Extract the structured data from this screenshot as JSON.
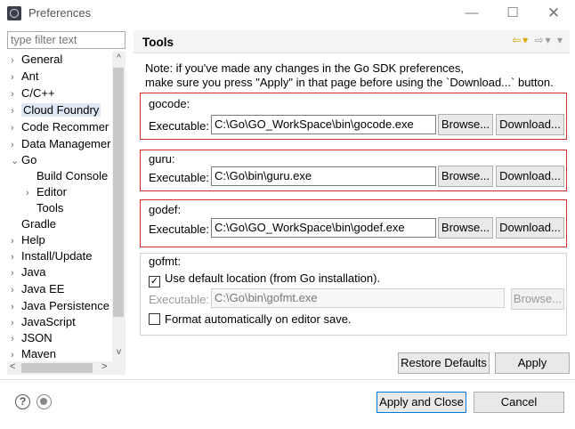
{
  "window": {
    "title": "Preferences",
    "minimize": "—",
    "maximize": "☐",
    "close": "✕"
  },
  "sidebar": {
    "filter_placeholder": "type filter text",
    "items": [
      {
        "label": "General",
        "arrow": "›"
      },
      {
        "label": "Ant",
        "arrow": "›"
      },
      {
        "label": "C/C++",
        "arrow": "›"
      },
      {
        "label": "Cloud Foundry",
        "arrow": "›"
      },
      {
        "label": "Code Recommer",
        "arrow": "›"
      },
      {
        "label": "Data Managemer",
        "arrow": "›"
      },
      {
        "label": "Go",
        "arrow": "⌄"
      },
      {
        "label": "Build Console",
        "arrow": ""
      },
      {
        "label": "Editor",
        "arrow": "›"
      },
      {
        "label": "Tools",
        "arrow": ""
      },
      {
        "label": "Gradle",
        "arrow": ""
      },
      {
        "label": "Help",
        "arrow": "›"
      },
      {
        "label": "Install/Update",
        "arrow": "›"
      },
      {
        "label": "Java",
        "arrow": "›"
      },
      {
        "label": "Java EE",
        "arrow": "›"
      },
      {
        "label": "Java Persistence",
        "arrow": "›"
      },
      {
        "label": "JavaScript",
        "arrow": "›"
      },
      {
        "label": "JSON",
        "arrow": "›"
      },
      {
        "label": "Maven",
        "arrow": "›"
      }
    ]
  },
  "panel": {
    "title": "Tools",
    "note_line1": "Note: if you've made any changes in the Go SDK preferences,",
    "note_line2": "make sure you press \"Apply\" in that page before using the `Download...` button.",
    "executable_label": "Executable:",
    "browse_label": "Browse...",
    "download_label": "Download...",
    "gocode": {
      "title": "gocode:",
      "path": "C:\\Go\\GO_WorkSpace\\bin\\gocode.exe"
    },
    "guru": {
      "title": "guru:",
      "path": "C:\\Go\\bin\\guru.exe"
    },
    "godef": {
      "title": "godef:",
      "path": "C:\\Go\\GO_WorkSpace\\bin\\godef.exe"
    },
    "gofmt": {
      "title": "gofmt:",
      "use_default_label": "Use default location (from Go installation).",
      "use_default_checked": true,
      "path": "C:\\Go\\bin\\gofmt.exe",
      "format_on_save_label": "Format automatically on editor save.",
      "format_on_save_checked": false
    },
    "restore_defaults": "Restore Defaults",
    "apply": "Apply"
  },
  "footer": {
    "apply_and_close": "Apply and Close",
    "cancel": "Cancel",
    "help_glyph": "?"
  },
  "accent_colors": {
    "highlight_box": "#d62b2b",
    "selection": "#dfe7f5",
    "default_button_border": "#0078d7"
  }
}
